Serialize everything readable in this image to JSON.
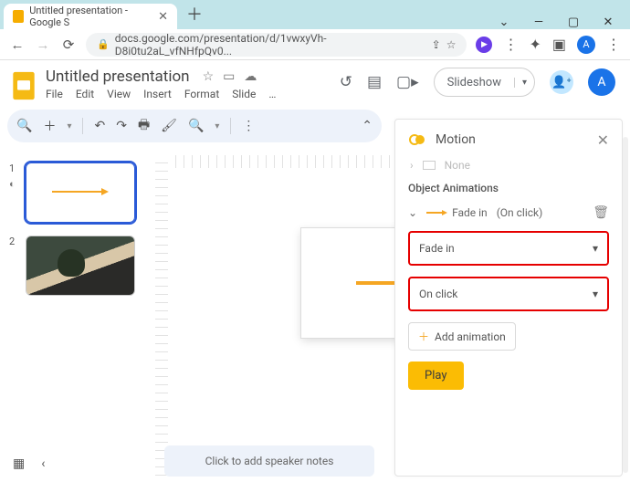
{
  "tab": {
    "title": "Untitled presentation - Google S"
  },
  "wincontrols": {
    "down": "⌄",
    "min": "—",
    "max": "▢",
    "close": "✕"
  },
  "nav": {
    "back": "←",
    "fwd": "→",
    "reload": "⟳"
  },
  "addr": {
    "lock": "🔒",
    "url": "docs.google.com/presentation/d/1vwxyVh-D8i0tu2aL_vfNHfpQv0...",
    "share": "⇪",
    "star": "☆"
  },
  "ext": {
    "play": "▶",
    "dots": "⋮",
    "puzzle": "✦",
    "box": "▣"
  },
  "account": {
    "initial": "A"
  },
  "doc": {
    "title": "Untitled presentation",
    "icons": {
      "star": "☆",
      "folder": "▭",
      "cloud": "☁"
    },
    "menus": [
      "File",
      "Edit",
      "View",
      "Insert",
      "Format",
      "Slide",
      "…"
    ]
  },
  "hdrright": {
    "history": "↺",
    "comment": "▤",
    "video": "▢▸",
    "slideshow": "Slideshow",
    "dd": "▾",
    "share": "👤⁺"
  },
  "toolbar": {
    "search": "🔍",
    "plus": "＋",
    "undo": "↶",
    "redo": "↷",
    "print": "🖶",
    "paint": "🖌",
    "zoom": "🔍",
    "dd": "▾",
    "more": "⋮",
    "chev": "⌃"
  },
  "thumbs": {
    "s1": "1",
    "s2": "2"
  },
  "speaker": {
    "hint": "Click to add speaker notes"
  },
  "btm": {
    "grid": "▦",
    "back": "‹"
  },
  "panel": {
    "title": "Motion",
    "close": "✕",
    "ghost": "None",
    "section": "Object Animations",
    "anim": {
      "chev": "⌄",
      "label": "Fade in",
      "trigger": "(On click)",
      "trash": "🗑"
    },
    "type": {
      "value": "Fade in",
      "dd": "▾"
    },
    "trigger": {
      "value": "On click",
      "dd": "▾"
    },
    "add": {
      "plus": "＋",
      "label": "Add animation"
    },
    "play": {
      "label": "Play"
    }
  }
}
